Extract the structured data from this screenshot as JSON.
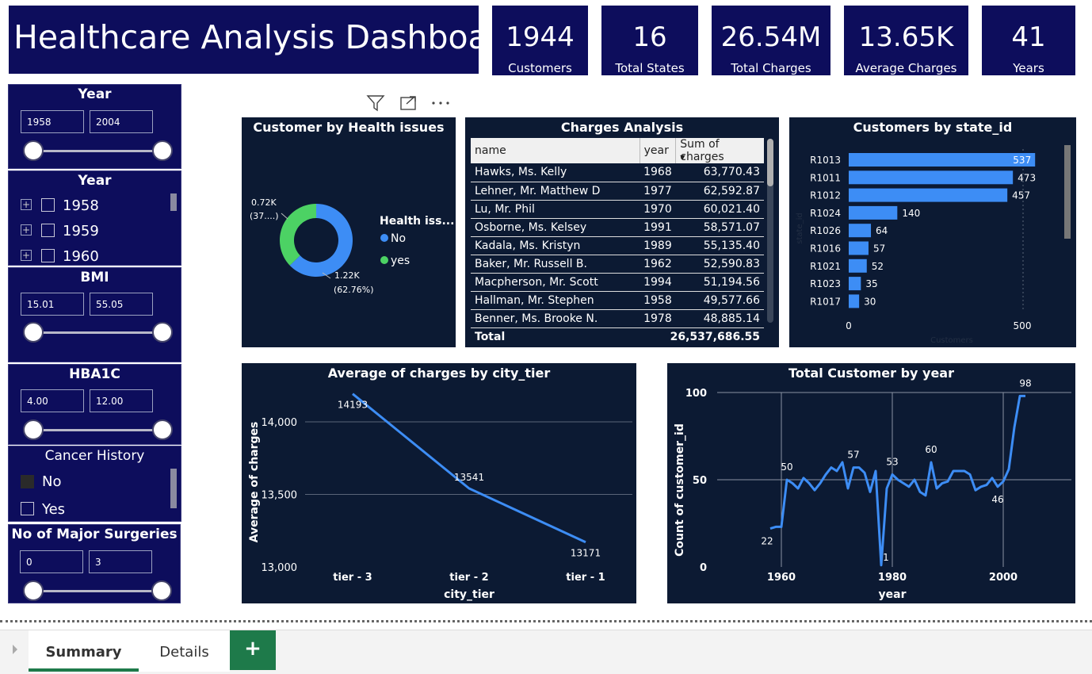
{
  "header": {
    "title": "Healthcare Analysis Dashboard"
  },
  "kpis": [
    {
      "value": "1944",
      "label": "Customers"
    },
    {
      "value": "16",
      "label": "Total States"
    },
    {
      "value": "26.54M",
      "label": "Total Charges"
    },
    {
      "value": "13.65K",
      "label": "Average Charges"
    },
    {
      "value": "41",
      "label": "Years"
    }
  ],
  "slicers": {
    "year_range": {
      "title": "Year",
      "min": "1958",
      "max": "2004"
    },
    "year_list": {
      "title": "Year",
      "items": [
        "1958",
        "1959",
        "1960"
      ]
    },
    "bmi": {
      "title": "BMI",
      "min": "15.01",
      "max": "55.05"
    },
    "hba1c": {
      "title": "HBA1C",
      "min": "4.00",
      "max": "12.00"
    },
    "cancer": {
      "title": "Cancer History",
      "items": [
        "No",
        "Yes"
      ]
    },
    "surgeries": {
      "title": "No of Major Surgeries",
      "min": "0",
      "max": "3"
    }
  },
  "visual_header_icons": [
    "filter-icon",
    "focus-mode-icon",
    "more-options-icon"
  ],
  "donut": {
    "title": "Customer by Health issues",
    "legend_title": "Health iss...",
    "colors": {
      "No": "#3d8df5",
      "yes": "#4cd264"
    },
    "labels": {
      "yes_value": "0.72K",
      "yes_pct": "(37....)",
      "no_value": "1.22K",
      "no_pct": "(62.76%)"
    },
    "chart_data": {
      "type": "pie",
      "categories": [
        "No",
        "yes"
      ],
      "values": [
        1.22,
        0.72
      ],
      "percent": [
        62.76,
        37.24
      ]
    }
  },
  "charges_table": {
    "title": "Charges Analysis",
    "columns": [
      "name",
      "year",
      "Sum of charges"
    ],
    "rows": [
      [
        "Hawks, Ms. Kelly",
        "1968",
        "63,770.43"
      ],
      [
        "Lehner, Mr. Matthew D",
        "1977",
        "62,592.87"
      ],
      [
        "Lu, Mr. Phil",
        "1970",
        "60,021.40"
      ],
      [
        "Osborne, Ms. Kelsey",
        "1991",
        "58,571.07"
      ],
      [
        "Kadala, Ms. Kristyn",
        "1989",
        "55,135.40"
      ],
      [
        "Baker, Mr. Russell B.",
        "1962",
        "52,590.83"
      ],
      [
        "Macpherson, Mr. Scott",
        "1994",
        "51,194.56"
      ],
      [
        "Hallman, Mr. Stephen",
        "1958",
        "49,577.66"
      ],
      [
        "Benner, Ms. Brooke N.",
        "1978",
        "48,885.14"
      ]
    ],
    "total_label": "Total",
    "total_value": "26,537,686.55"
  },
  "state_chart": {
    "title": "Customers by state_id",
    "bar_color": "#3d8df5",
    "chart_data": {
      "type": "bar",
      "orientation": "horizontal",
      "categories": [
        "R1013",
        "R1011",
        "R1012",
        "R1024",
        "R1026",
        "R1016",
        "R1021",
        "R1023",
        "R1017"
      ],
      "values": [
        537,
        473,
        457,
        140,
        64,
        57,
        52,
        35,
        30
      ],
      "xticks": [
        "0",
        "500"
      ],
      "xlim": [
        0,
        560
      ],
      "ylabel": "state_id",
      "xlabel": "Customers"
    }
  },
  "city_chart": {
    "title": "Average of charges by city_tier",
    "line_color": "#3d8df5",
    "chart_data": {
      "type": "line",
      "categories": [
        "tier - 3",
        "tier - 2",
        "tier - 1"
      ],
      "values": [
        14193,
        13541,
        13171
      ],
      "yticks": [
        "13,000",
        "13,500",
        "14,000"
      ],
      "ylim": [
        13000,
        14200
      ],
      "xlabel": "city_tier",
      "ylabel": "Average of charges"
    }
  },
  "year_chart": {
    "title": "Total Customer by year",
    "line_color": "#3d8df5",
    "chart_data": {
      "type": "line",
      "x": [
        1958,
        1959,
        1960,
        1961,
        1962,
        1963,
        1964,
        1965,
        1966,
        1967,
        1968,
        1969,
        1970,
        1971,
        1972,
        1973,
        1974,
        1975,
        1976,
        1977,
        1978,
        1979,
        1980,
        1981,
        1982,
        1983,
        1984,
        1985,
        1986,
        1987,
        1988,
        1989,
        1990,
        1991,
        1992,
        1993,
        1994,
        1995,
        1996,
        1997,
        1998,
        1999,
        2000,
        2001,
        2002,
        2003,
        2004
      ],
      "y": [
        22,
        23,
        23,
        50,
        48,
        45,
        51,
        48,
        44,
        48,
        53,
        57,
        55,
        60,
        45,
        57,
        57,
        54,
        43,
        55,
        1,
        45,
        53,
        50,
        48,
        46,
        50,
        43,
        41,
        60,
        45,
        48,
        49,
        55,
        55,
        55,
        53,
        44,
        46,
        47,
        51,
        46,
        49,
        56,
        80,
        98,
        98
      ],
      "point_labels": [
        {
          "x": 1958,
          "y": 22,
          "text": "22"
        },
        {
          "x": 1961,
          "y": 50,
          "text": "50"
        },
        {
          "x": 1973,
          "y": 57,
          "text": "57"
        },
        {
          "x": 1978,
          "y": 1,
          "text": "1"
        },
        {
          "x": 1980,
          "y": 53,
          "text": "53"
        },
        {
          "x": 1987,
          "y": 60,
          "text": "60"
        },
        {
          "x": 1999,
          "y": 46,
          "text": "46"
        },
        {
          "x": 2004,
          "y": 98,
          "text": "98"
        }
      ],
      "xticks": [
        "1960",
        "1980",
        "2000"
      ],
      "yticks": [
        "0",
        "50",
        "100"
      ],
      "xlim": [
        1954,
        2007
      ],
      "ylim": [
        0,
        100
      ],
      "xlabel": "year",
      "ylabel": "Count of customer_id"
    }
  },
  "tabs": {
    "summary": "Summary",
    "details": "Details",
    "add": "+"
  }
}
